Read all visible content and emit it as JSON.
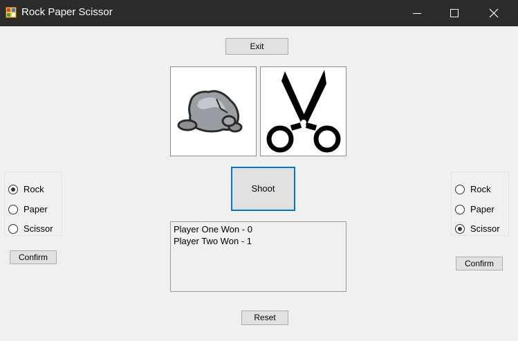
{
  "window": {
    "title": "Rock Paper Scissor",
    "icon": "app-icon",
    "minimize_icon": "minimize-icon",
    "maximize_icon": "maximize-icon",
    "close_icon": "close-icon"
  },
  "buttons": {
    "exit": "Exit",
    "shoot": "Shoot",
    "reset": "Reset",
    "confirm_left": "Confirm",
    "confirm_right": "Confirm"
  },
  "player_one": {
    "options": [
      {
        "label": "Rock",
        "checked": true
      },
      {
        "label": "Paper",
        "checked": false
      },
      {
        "label": "Scissor",
        "checked": false
      }
    ]
  },
  "player_two": {
    "options": [
      {
        "label": "Rock",
        "checked": false
      },
      {
        "label": "Paper",
        "checked": false
      },
      {
        "label": "Scissor",
        "checked": true
      }
    ]
  },
  "images": {
    "left": "rock-image",
    "right": "scissors-image"
  },
  "results": [
    "Player One Won - 0",
    "Player Two Won - 1"
  ],
  "colors": {
    "titlebar": "#2b2b2b",
    "focus_border": "#0078d7",
    "window_bg": "#f0f0f0"
  }
}
